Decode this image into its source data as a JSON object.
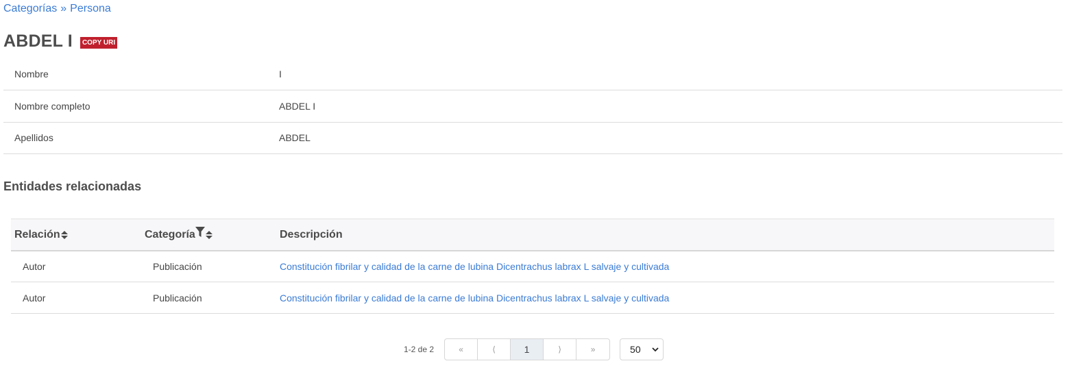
{
  "breadcrumb": {
    "root": "Categorías",
    "separator": "»",
    "current": "Persona"
  },
  "entity": {
    "title": "ABDEL I",
    "copy_uri_label": "COPY URI"
  },
  "properties": [
    {
      "key": "Nombre",
      "value": "I"
    },
    {
      "key": "Nombre completo",
      "value": "ABDEL I"
    },
    {
      "key": "Apellidos",
      "value": "ABDEL"
    }
  ],
  "related": {
    "section_title": "Entidades relacionadas",
    "columns": {
      "relation": "Relación",
      "category": "Categoría",
      "description": "Descripción"
    },
    "rows": [
      {
        "relation": "Autor",
        "category": "Publicación",
        "description": "Constitución fibrilar y calidad de la carne de lubina Dicentrachus labrax L salvaje y cultivada"
      },
      {
        "relation": "Autor",
        "category": "Publicación",
        "description": "Constitución fibrilar y calidad de la carne de lubina Dicentrachus labrax L salvaje y cultivada"
      }
    ]
  },
  "pagination": {
    "count": "1-2 de 2",
    "first": "«",
    "prev": "⟨",
    "current_page": "1",
    "next": "⟩",
    "last": "»",
    "page_size": "50"
  },
  "icons": {
    "sort": "sort-icon",
    "filter": "filter-icon",
    "dropdown": "chevron-down-icon"
  },
  "colors": {
    "link": "#3a7bd5",
    "copy_uri_bg": "#c0202d",
    "header_bg": "#f7f7f9"
  }
}
